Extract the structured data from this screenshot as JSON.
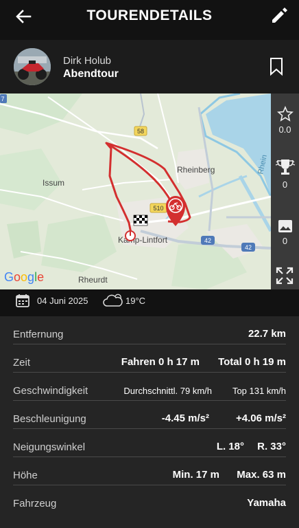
{
  "header": {
    "title": "TOURENDETAILS"
  },
  "profile": {
    "name": "Dirk Holub",
    "tour_name": "Abendtour"
  },
  "map": {
    "labels": {
      "rheinberg": "Rheinberg",
      "issum": "Issum",
      "kamp_lintfort": "Kamp-Lintfort",
      "rheurdt": "Rheurdt",
      "rhein": "Rhein",
      "google": "Google"
    },
    "road_shields": {
      "r58": "58",
      "r510": "510",
      "r42a": "42",
      "r42b": "42",
      "r7": "7"
    },
    "route_color": "#d32f2f"
  },
  "sidepanel": {
    "rating": "0.0",
    "trophies": "0",
    "photos": "0"
  },
  "info": {
    "date": "04 Juni 2025",
    "temperature": "19°C"
  },
  "stats": {
    "distance": {
      "label": "Entfernung",
      "value": "22.7 km"
    },
    "time": {
      "label": "Zeit",
      "riding": "Fahren 0 h 17 m",
      "total": "Total 0 h 19 m"
    },
    "speed": {
      "label": "Geschwindigkeit",
      "avg": "Durchschnittl. 79 km/h",
      "top": "Top 131 km/h"
    },
    "acceleration": {
      "label": "Beschleunigung",
      "min": "-4.45 m/s²",
      "max": "+4.06 m/s²"
    },
    "lean": {
      "label": "Neigungswinkel",
      "left": "L. 18°",
      "right": "R. 33°"
    },
    "altitude": {
      "label": "Höhe",
      "min": "Min. 17 m",
      "max": "Max. 63 m"
    },
    "vehicle": {
      "label": "Fahrzeug",
      "value": "Yamaha"
    }
  }
}
